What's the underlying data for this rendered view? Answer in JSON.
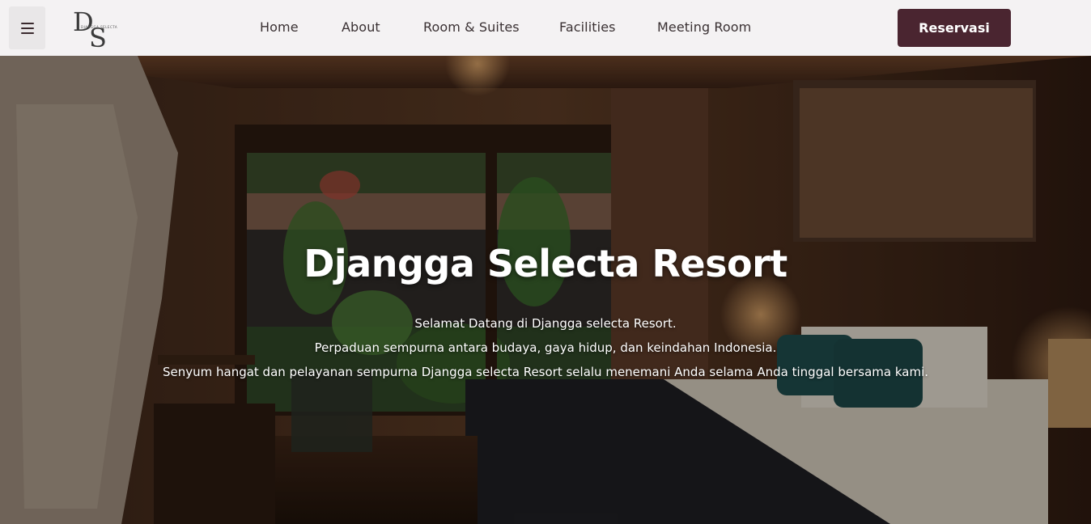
{
  "nav": {
    "menu_icon": "hamburger-menu-icon",
    "logo_icon": "ds-monogram-logo",
    "logo_text": "DJANGGA SELECTA",
    "links": [
      "Home",
      "About",
      "Room & Suites",
      "Facilities",
      "Meeting Room"
    ],
    "cta_label": "Reservasi"
  },
  "hero": {
    "title": "Djangga Selecta Resort",
    "lines": [
      "Selamat Datang di Djangga selecta Resort.",
      "Perpaduan sempurna antara budaya, gaya hidup, dan keindahan Indonesia.",
      "Senyum hangat dan pelayanan sempurna Djangga selecta Resort selalu menemani Anda selama Anda tinggal bersama kami."
    ]
  },
  "colors": {
    "navbar_bg": "#f4f2f3",
    "cta_bg": "#4a2530",
    "text_dark": "#3a3133"
  }
}
